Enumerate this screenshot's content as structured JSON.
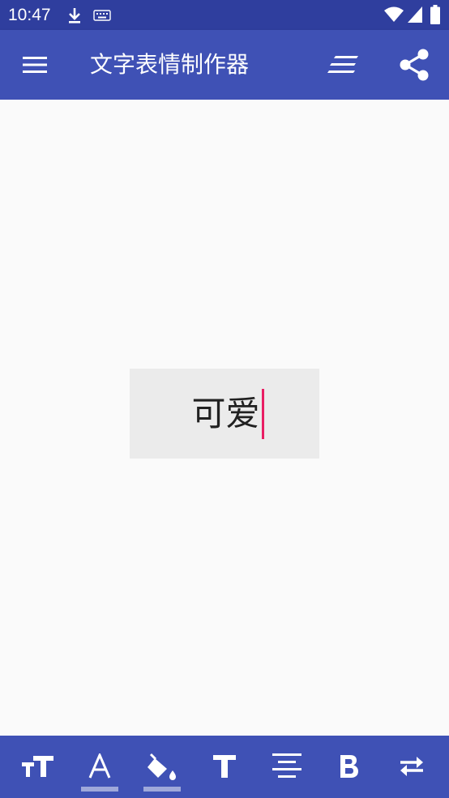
{
  "status_bar": {
    "time": "10:47",
    "icons": [
      "download-icon",
      "keyboard-icon",
      "wifi-icon",
      "signal-icon",
      "battery-icon"
    ]
  },
  "app_bar": {
    "title": "文字表情制作器",
    "menu_icon": "menu-icon",
    "align_icon": "text-align-icon",
    "share_icon": "share-icon"
  },
  "canvas": {
    "text": "可爱"
  },
  "toolbar": {
    "items": [
      {
        "name": "text-size",
        "icon": "text-size-icon"
      },
      {
        "name": "text-color",
        "icon": "text-color-icon",
        "glyph": "A"
      },
      {
        "name": "background-fill",
        "icon": "fill-bucket-icon"
      },
      {
        "name": "font",
        "icon": "font-icon",
        "glyph": "T"
      },
      {
        "name": "align-center",
        "icon": "align-center-icon"
      },
      {
        "name": "bold",
        "icon": "bold-icon",
        "glyph": "B"
      },
      {
        "name": "swap",
        "icon": "swap-icon"
      }
    ]
  },
  "colors": {
    "status_bar": "#2f3e9e",
    "primary": "#3f51b5",
    "accent": "#e91e63",
    "indicator": "#9fa8da",
    "canvas_bg": "#fafafa",
    "text_box_bg": "#ebebeb"
  }
}
